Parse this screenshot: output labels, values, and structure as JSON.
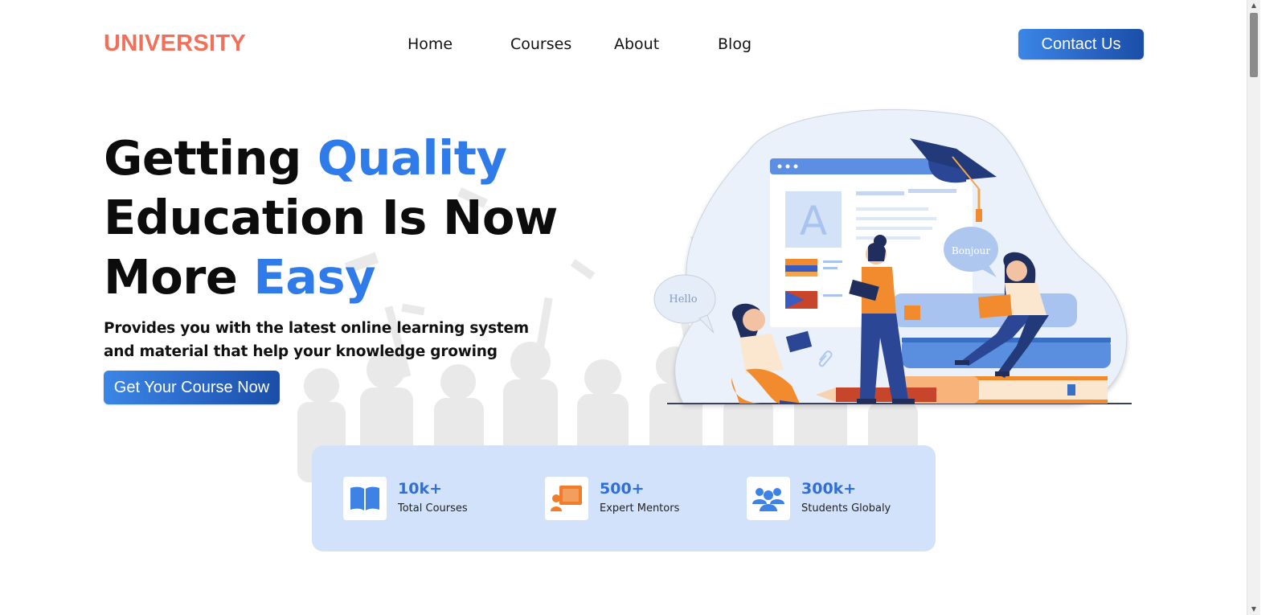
{
  "brand": {
    "logo": "UNIVERSITY",
    "color": "#f26f5a"
  },
  "nav": {
    "items": [
      "Home",
      "Courses",
      "About",
      "Blog"
    ],
    "contact": "Contact Us"
  },
  "hero": {
    "title_part1": "Getting ",
    "title_accent1": "Quality",
    "title_line2": "Education Is Now",
    "title_part3": "More ",
    "title_accent2": "Easy",
    "subtitle": "Provides you with the latest online learning system and material that help your knowledge growing",
    "cta": "Get Your Course Now",
    "accent_color": "#2f7bea"
  },
  "illustration": {
    "bubble_left": "Hello",
    "bubble_right": "Bonjour",
    "board_letter": "A"
  },
  "stats": [
    {
      "value": "10k+",
      "label": "Total Courses",
      "icon": "book-icon"
    },
    {
      "value": "500+",
      "label": "Expert Mentors",
      "icon": "mentor-icon"
    },
    {
      "value": "300k+",
      "label": "Students Globaly",
      "icon": "students-icon"
    }
  ]
}
